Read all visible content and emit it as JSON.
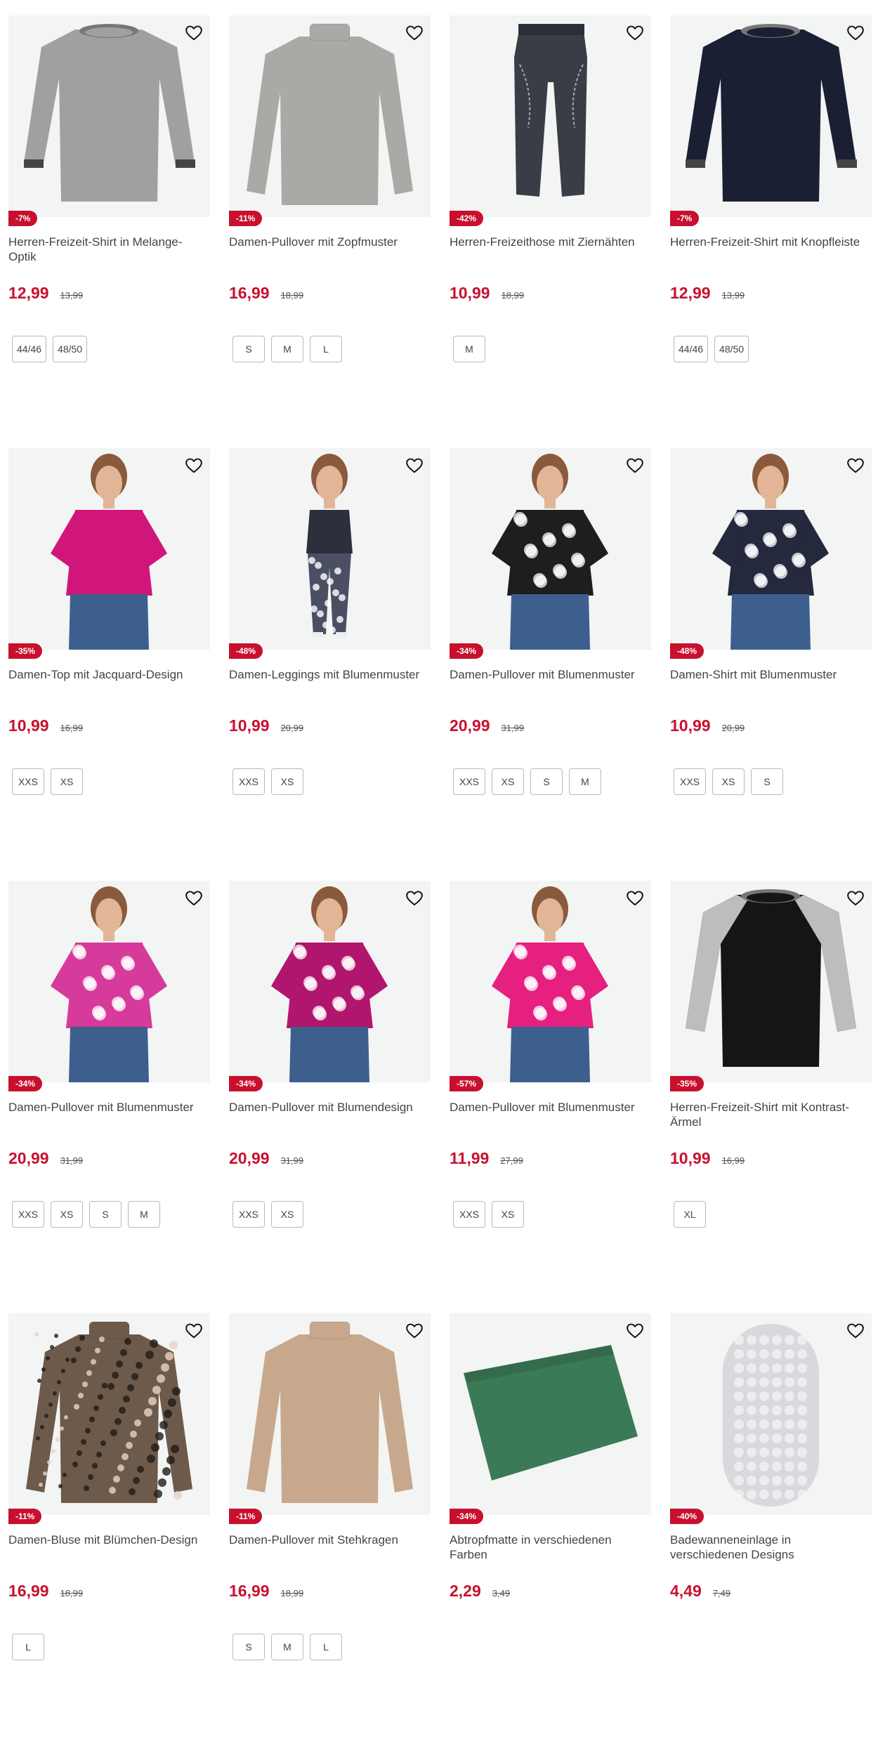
{
  "colors": {
    "accent": "#c8102e",
    "image_bg": "#f3f4f4",
    "size_border": "#b9b9b9"
  },
  "products": [
    {
      "title": "Herren-Freizeit-Shirt in Melange-Optik",
      "discount": "-7%",
      "price": "12,99",
      "old_price": "13,99",
      "sizes": [
        "44/46",
        "48/50"
      ],
      "art": "shirt",
      "color": "#a0a0a0"
    },
    {
      "title": "Damen-Pullover mit Zopfmuster",
      "discount": "-11%",
      "price": "16,99",
      "old_price": "18,99",
      "sizes": [
        "S",
        "M",
        "L"
      ],
      "art": "sweater",
      "color": "#a9aaa6"
    },
    {
      "title": "Herren-Freizeithose mit Ziernähten",
      "discount": "-42%",
      "price": "10,99",
      "old_price": "18,99",
      "sizes": [
        "M"
      ],
      "art": "pants",
      "color": "#3a3d46"
    },
    {
      "title": "Herren-Freizeit-Shirt mit Knopfleiste",
      "discount": "-7%",
      "price": "12,99",
      "old_price": "13,99",
      "sizes": [
        "44/46",
        "48/50"
      ],
      "art": "shirt",
      "color": "#1b1f33"
    },
    {
      "title": "Damen-Top mit Jacquard-Design",
      "discount": "-35%",
      "price": "10,99",
      "old_price": "16,99",
      "sizes": [
        "XXS",
        "XS"
      ],
      "art": "model",
      "color": "#d1167b"
    },
    {
      "title": "Damen-Leggings mit Blumenmuster",
      "discount": "-48%",
      "price": "10,99",
      "old_price": "20,99",
      "sizes": [
        "XXS",
        "XS"
      ],
      "art": "model-full",
      "color": "#2d2f3d"
    },
    {
      "title": "Damen-Pullover mit Blumenmuster",
      "discount": "-34%",
      "price": "20,99",
      "old_price": "31,99",
      "sizes": [
        "XXS",
        "XS",
        "S",
        "M"
      ],
      "art": "model",
      "color": "#1e1e1e"
    },
    {
      "title": "Damen-Shirt mit Blumenmuster",
      "discount": "-48%",
      "price": "10,99",
      "old_price": "20,99",
      "sizes": [
        "XXS",
        "XS",
        "S"
      ],
      "art": "model",
      "color": "#25293d"
    },
    {
      "title": "Damen-Pullover mit Blumenmuster",
      "discount": "-34%",
      "price": "20,99",
      "old_price": "31,99",
      "sizes": [
        "XXS",
        "XS",
        "S",
        "M"
      ],
      "art": "model",
      "color": "#d63a9a"
    },
    {
      "title": "Damen-Pullover mit Blumendesign",
      "discount": "-34%",
      "price": "20,99",
      "old_price": "31,99",
      "sizes": [
        "XXS",
        "XS"
      ],
      "art": "model",
      "color": "#b0166e"
    },
    {
      "title": "Damen-Pullover mit Blumenmuster",
      "discount": "-57%",
      "price": "11,99",
      "old_price": "27,99",
      "sizes": [
        "XXS",
        "XS"
      ],
      "art": "model",
      "color": "#e5207f"
    },
    {
      "title": "Herren-Freizeit-Shirt mit Kontrast-Ärmel",
      "discount": "-35%",
      "price": "10,99",
      "old_price": "16,99",
      "sizes": [
        "XL"
      ],
      "art": "raglan",
      "color": "#151515"
    },
    {
      "title": "Damen-Bluse mit Blümchen-Design",
      "discount": "-11%",
      "price": "16,99",
      "old_price": "18,99",
      "sizes": [
        "L"
      ],
      "art": "blouse",
      "color": "#6d5a4b"
    },
    {
      "title": "Damen-Pullover mit Stehkragen",
      "discount": "-11%",
      "price": "16,99",
      "old_price": "18,99",
      "sizes": [
        "S",
        "M",
        "L"
      ],
      "art": "sweater",
      "color": "#c8a88c"
    },
    {
      "title": "Abtropfmatte in verschiedenen Farben",
      "discount": "-34%",
      "price": "2,29",
      "old_price": "3,49",
      "sizes": [],
      "art": "mat",
      "color": "#3b7a57"
    },
    {
      "title": "Badewanneneinlage in verschiedenen Designs",
      "discount": "-40%",
      "price": "4,49",
      "old_price": "7,49",
      "sizes": [],
      "art": "bathmat",
      "color": "#d7d9dc"
    }
  ]
}
